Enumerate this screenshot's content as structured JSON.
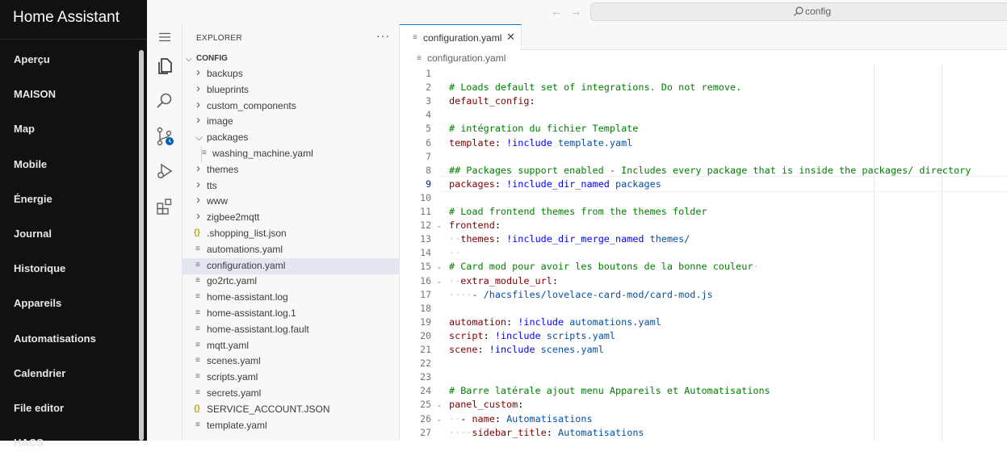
{
  "ha_sidebar": {
    "title": "Home Assistant",
    "items": [
      "Aperçu",
      "MAISON",
      "Map",
      "Mobile",
      "Énergie",
      "Journal",
      "Historique",
      "Appareils",
      "Automatisations",
      "Calendrier",
      "File editor",
      "HACS"
    ]
  },
  "topbar": {
    "back_icon": "arrow-left-icon",
    "forward_icon": "arrow-right-icon",
    "search_text": "config"
  },
  "activity_bar": [
    "explorer-icon",
    "search-icon",
    "source-control-icon",
    "run-debug-icon",
    "extensions-icon"
  ],
  "explorer": {
    "title": "EXPLORER",
    "more": "···",
    "root": "CONFIG",
    "items": [
      {
        "label": "backups",
        "type": "folder",
        "expanded": false
      },
      {
        "label": "blueprints",
        "type": "folder",
        "expanded": false
      },
      {
        "label": "custom_components",
        "type": "folder",
        "expanded": false
      },
      {
        "label": "image",
        "type": "folder",
        "expanded": false
      },
      {
        "label": "packages",
        "type": "folder",
        "expanded": true
      },
      {
        "label": "washing_machine.yaml",
        "type": "file",
        "nested": true
      },
      {
        "label": "themes",
        "type": "folder",
        "expanded": false
      },
      {
        "label": "tts",
        "type": "folder",
        "expanded": false
      },
      {
        "label": "www",
        "type": "folder",
        "expanded": false
      },
      {
        "label": "zigbee2mqtt",
        "type": "folder",
        "expanded": false
      },
      {
        "label": ".shopping_list.json",
        "type": "json"
      },
      {
        "label": "automations.yaml",
        "type": "file"
      },
      {
        "label": "configuration.yaml",
        "type": "file",
        "selected": true
      },
      {
        "label": "go2rtc.yaml",
        "type": "file"
      },
      {
        "label": "home-assistant.log",
        "type": "file"
      },
      {
        "label": "home-assistant.log.1",
        "type": "file"
      },
      {
        "label": "home-assistant.log.fault",
        "type": "file"
      },
      {
        "label": "mqtt.yaml",
        "type": "file"
      },
      {
        "label": "scenes.yaml",
        "type": "file"
      },
      {
        "label": "scripts.yaml",
        "type": "file"
      },
      {
        "label": "secrets.yaml",
        "type": "file"
      },
      {
        "label": "SERVICE_ACCOUNT.JSON",
        "type": "json"
      },
      {
        "label": "template.yaml",
        "type": "file"
      }
    ]
  },
  "editor": {
    "tab_label": "configuration.yaml",
    "tab_close": "✕",
    "breadcrumb": "configuration.yaml",
    "current_line": 9,
    "lines": [
      {
        "n": "1",
        "parts": []
      },
      {
        "n": "2",
        "parts": [
          {
            "t": "# Loads default set of integrations. Do not remove.",
            "c": "comment"
          }
        ]
      },
      {
        "n": "3",
        "parts": [
          {
            "t": "default_config",
            "c": "key"
          },
          {
            "t": ":",
            "c": "plain"
          }
        ]
      },
      {
        "n": "4",
        "parts": []
      },
      {
        "n": "5",
        "parts": [
          {
            "t": "# intégration du fichier Template",
            "c": "comment"
          }
        ]
      },
      {
        "n": "6",
        "parts": [
          {
            "t": "template",
            "c": "key"
          },
          {
            "t": ": ",
            "c": "plain"
          },
          {
            "t": "!include",
            "c": "tag"
          },
          {
            "t": " template.yaml",
            "c": "val"
          }
        ]
      },
      {
        "n": "7",
        "parts": []
      },
      {
        "n": "8",
        "parts": [
          {
            "t": "## Packages support enabled - Includes every package that is inside the packages/ directory",
            "c": "comment"
          }
        ]
      },
      {
        "n": "9",
        "parts": [
          {
            "t": "packages",
            "c": "key"
          },
          {
            "t": ": ",
            "c": "plain"
          },
          {
            "t": "!include_dir_named",
            "c": "tag"
          },
          {
            "t": " packages",
            "c": "val"
          }
        ]
      },
      {
        "n": "10",
        "parts": []
      },
      {
        "n": "11",
        "parts": [
          {
            "t": "# Load frontend themes from the themes folder",
            "c": "comment"
          }
        ]
      },
      {
        "n": "12",
        "parts": [
          {
            "t": "frontend",
            "c": "key"
          },
          {
            "t": ":",
            "c": "plain"
          }
        ]
      },
      {
        "n": "13",
        "parts": [
          {
            "t": "··",
            "c": "ws"
          },
          {
            "t": "themes",
            "c": "key"
          },
          {
            "t": ": ",
            "c": "plain"
          },
          {
            "t": "!include_dir_merge_named",
            "c": "tag"
          },
          {
            "t": " themes/",
            "c": "val"
          }
        ]
      },
      {
        "n": "14",
        "parts": [
          {
            "t": "··",
            "c": "ws"
          }
        ]
      },
      {
        "n": "15",
        "parts": [
          {
            "t": "# Card mod pour avoir les boutons de la bonne couleur",
            "c": "comment"
          },
          {
            "t": "·",
            "c": "ws"
          }
        ]
      },
      {
        "n": "16",
        "parts": [
          {
            "t": "··",
            "c": "ws"
          },
          {
            "t": "extra_module_url",
            "c": "key"
          },
          {
            "t": ":",
            "c": "plain"
          }
        ]
      },
      {
        "n": "17",
        "parts": [
          {
            "t": "····",
            "c": "ws"
          },
          {
            "t": "- /hacsfiles/lovelace-card-mod/card-mod.js",
            "c": "val"
          }
        ]
      },
      {
        "n": "18",
        "parts": []
      },
      {
        "n": "19",
        "parts": [
          {
            "t": "automation",
            "c": "key"
          },
          {
            "t": ": ",
            "c": "plain"
          },
          {
            "t": "!include",
            "c": "tag"
          },
          {
            "t": " automations.yaml",
            "c": "val"
          }
        ]
      },
      {
        "n": "20",
        "parts": [
          {
            "t": "script",
            "c": "key"
          },
          {
            "t": ": ",
            "c": "plain"
          },
          {
            "t": "!include",
            "c": "tag"
          },
          {
            "t": " scripts.yaml",
            "c": "val"
          }
        ]
      },
      {
        "n": "21",
        "parts": [
          {
            "t": "scene",
            "c": "key"
          },
          {
            "t": ": ",
            "c": "plain"
          },
          {
            "t": "!include",
            "c": "tag"
          },
          {
            "t": " scenes.yaml",
            "c": "val"
          }
        ]
      },
      {
        "n": "22",
        "parts": []
      },
      {
        "n": "23",
        "parts": []
      },
      {
        "n": "24",
        "parts": [
          {
            "t": "# Barre latérale ajout menu Appareils et Automatisations",
            "c": "comment"
          }
        ]
      },
      {
        "n": "25",
        "parts": [
          {
            "t": "panel_custom",
            "c": "key"
          },
          {
            "t": ":",
            "c": "plain"
          }
        ]
      },
      {
        "n": "26",
        "parts": [
          {
            "t": "··",
            "c": "ws"
          },
          {
            "t": "- ",
            "c": "plain"
          },
          {
            "t": "name",
            "c": "key"
          },
          {
            "t": ": ",
            "c": "plain"
          },
          {
            "t": "Automatisations",
            "c": "val"
          }
        ]
      },
      {
        "n": "27",
        "parts": [
          {
            "t": "····",
            "c": "ws"
          },
          {
            "t": "sidebar_title",
            "c": "key"
          },
          {
            "t": ": ",
            "c": "plain"
          },
          {
            "t": "Automatisations",
            "c": "val"
          }
        ]
      }
    ]
  },
  "colors": {
    "comment": "#008000",
    "key": "#800000",
    "tag": "#0000ff",
    "value": "#0451a5",
    "accent": "#0078d4"
  }
}
